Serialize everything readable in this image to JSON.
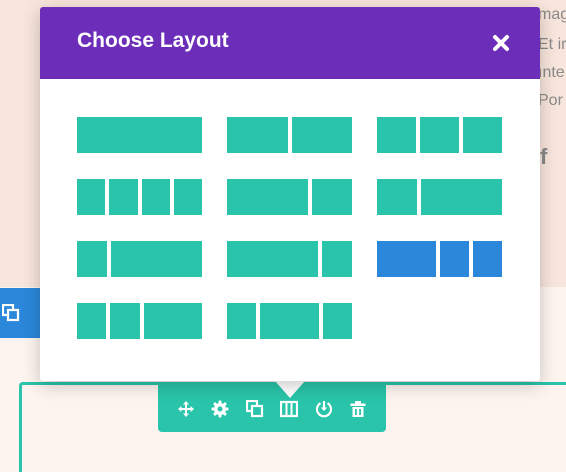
{
  "background": {
    "text_lines": [
      "mag",
      "Et ir",
      "ınte",
      "Por"
    ],
    "social_icon": "f"
  },
  "modal": {
    "title": "Choose Layout",
    "close_icon": "close-icon",
    "layouts": [
      {
        "name": "1",
        "cols": [
          1
        ],
        "selected": false
      },
      {
        "name": "1/2+1/2",
        "cols": [
          1,
          1
        ],
        "selected": false
      },
      {
        "name": "1/3+1/3+1/3",
        "cols": [
          1,
          1,
          1
        ],
        "selected": false
      },
      {
        "name": "1/4x4",
        "cols": [
          1,
          1,
          1,
          1
        ],
        "selected": false
      },
      {
        "name": "2/3+1/3",
        "cols": [
          2,
          1
        ],
        "selected": false
      },
      {
        "name": "1/3+2/3",
        "cols": [
          1,
          2
        ],
        "selected": false
      },
      {
        "name": "1/4+3/4",
        "cols": [
          1,
          3
        ],
        "selected": false
      },
      {
        "name": "3/4+1/4",
        "cols": [
          3,
          1
        ],
        "selected": false
      },
      {
        "name": "1/2+1/4+1/4",
        "cols": [
          2,
          1,
          1
        ],
        "selected": true
      },
      {
        "name": "1/4+1/4+1/2",
        "cols": [
          1,
          1,
          2
        ],
        "selected": false
      },
      {
        "name": "1/4+1/2+1/4",
        "cols": [
          1,
          2,
          1
        ],
        "selected": false
      }
    ]
  },
  "toolbar": {
    "icons": [
      "move-icon",
      "settings-icon",
      "duplicate-icon",
      "columns-icon",
      "save-icon",
      "delete-icon"
    ]
  },
  "colors": {
    "header": "#6c2eb9",
    "column": "#29c4a9",
    "selected_column": "#2b87da",
    "toolbar": "#29c4a9",
    "section_bar": "#2b87da"
  }
}
